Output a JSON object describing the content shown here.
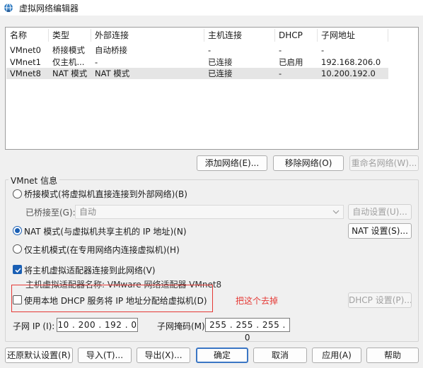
{
  "window": {
    "title": "虚拟网络编辑器"
  },
  "columns": [
    "名称",
    "类型",
    "外部连接",
    "主机连接",
    "DHCP",
    "子网地址"
  ],
  "rows": [
    {
      "name": "VMnet0",
      "type": "桥接模式",
      "external": "自动桥接",
      "host": "-",
      "dhcp": "-",
      "subnet": "-"
    },
    {
      "name": "VMnet1",
      "type": "仅主机...",
      "external": "-",
      "host": "已连接",
      "dhcp": "已启用",
      "subnet": "192.168.206.0"
    },
    {
      "name": "VMnet8",
      "type": "NAT 模式",
      "external": "NAT 模式",
      "host": "已连接",
      "dhcp": "-",
      "subnet": "10.200.192.0"
    }
  ],
  "list_buttons": {
    "add": "添加网络(E)...",
    "remove": "移除网络(O)",
    "rename": "重命名网络(W)..."
  },
  "vmnet_info": {
    "title": "VMnet 信息",
    "bridged_label": "桥接模式(将虚拟机直接连接到外部网络)(B)",
    "bridged_to_label": "已桥接至(G):",
    "bridged_to_value": "自动",
    "auto_settings": "自动设置(U)...",
    "nat_label": "NAT 模式(与虚拟机共享主机的 IP 地址)(N)",
    "nat_settings": "NAT 设置(S)...",
    "hostonly_label": "仅主机模式(在专用网络内连接虚拟机)(H)",
    "connect_adapter_label": "将主机虚拟适配器连接到此网络(V)",
    "adapter_name_label": "主机虚拟适配器名称: VMware 网络适配器 VMnet8",
    "dhcp_label": "使用本地 DHCP 服务将 IP 地址分配给虚拟机(D)",
    "dhcp_settings": "DHCP 设置(P)...",
    "annotation": "把这个去掉",
    "subnet_ip_label": "子网 IP (I):",
    "subnet_ip_value": "10 . 200 . 192 . 0",
    "subnet_mask_label": "子网掩码(M):",
    "subnet_mask_value": "255 . 255 . 255 . 0",
    "mode_selected": "nat",
    "connect_adapter_checked": true,
    "dhcp_checked": false
  },
  "footer": {
    "restore": "还原默认设置(R)",
    "import": "导入(T)...",
    "export": "导出(X)...",
    "ok": "确定",
    "cancel": "取消",
    "apply": "应用(A)",
    "help": "帮助"
  },
  "colors": {
    "accent": "#1a5fb4",
    "annotation": "#e53935",
    "selected_row": "#e5e5e5"
  }
}
